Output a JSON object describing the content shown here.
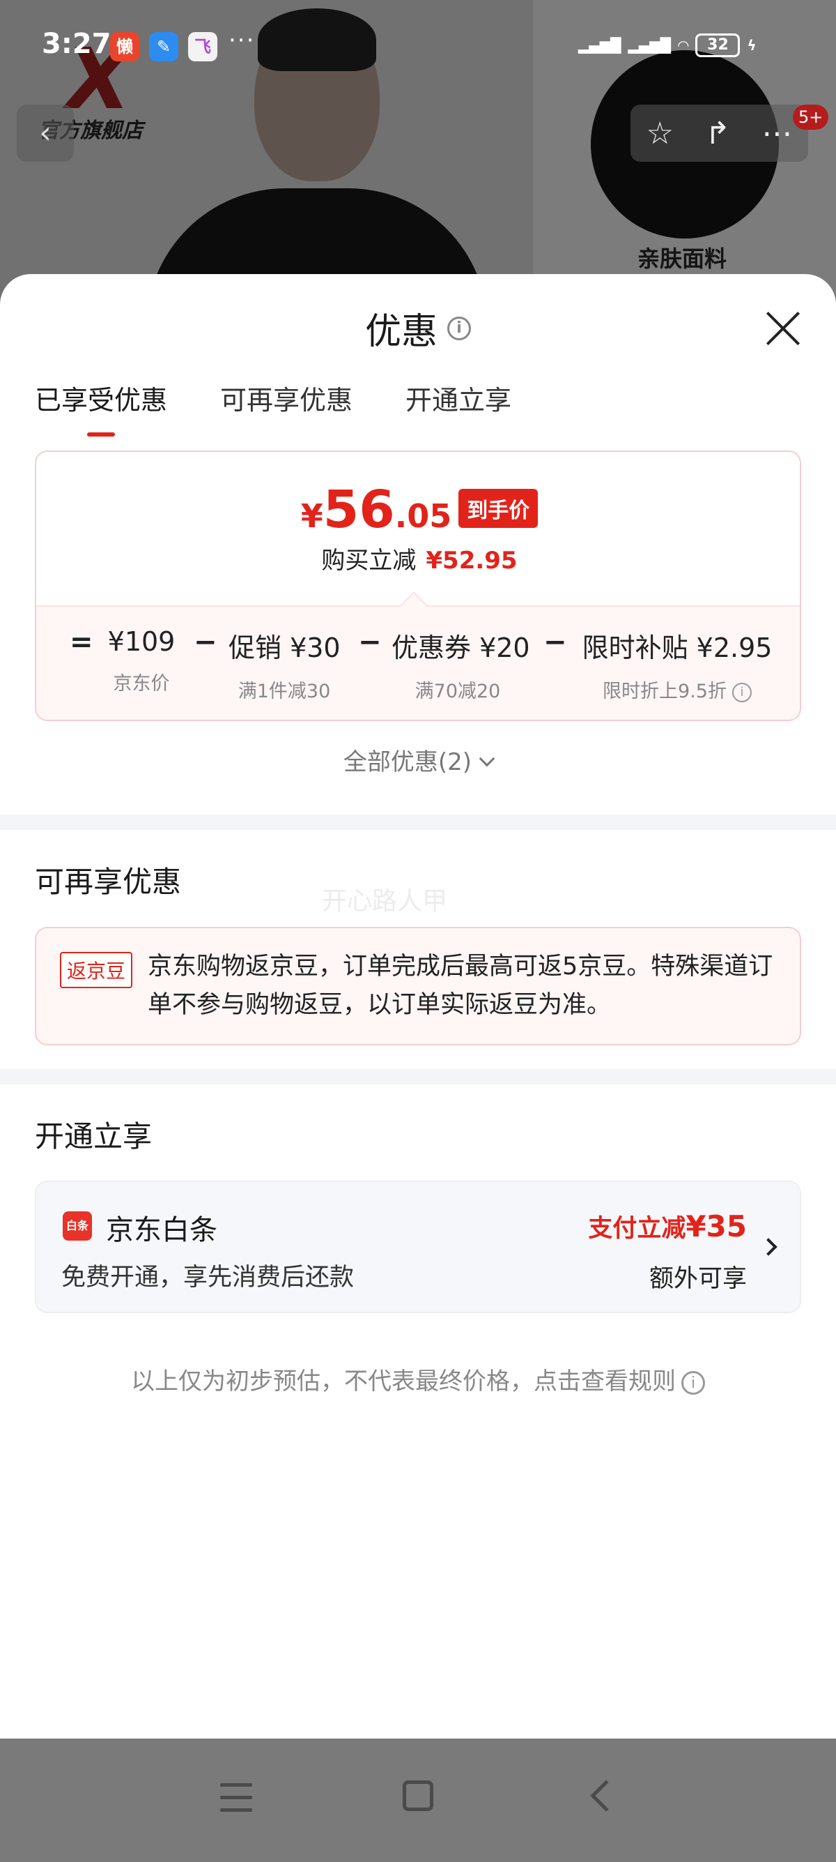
{
  "status_bar": {
    "time": "3:27",
    "app_icons": [
      "懒",
      "",
      "飞"
    ],
    "more": "···",
    "battery": "32"
  },
  "background_page": {
    "store_name": "官方旗舰店",
    "logo_letter": "X",
    "fabric_label": "亲肤面料",
    "badge": "5+"
  },
  "sheet": {
    "title": "优惠",
    "tabs": [
      "已享受优惠",
      "可再享优惠",
      "开通立享"
    ],
    "active_tab_index": 0,
    "final_price": {
      "currency": "¥",
      "integer": "56",
      "decimal": ".05",
      "tag": "到手价"
    },
    "savings": {
      "label": "购买立减",
      "amount": "¥52.95"
    },
    "breakdown": {
      "equals": "=",
      "minus": "−",
      "items": [
        {
          "value": "¥109",
          "sub": "京东价"
        },
        {
          "value": "促销 ¥30",
          "sub": "满1件减30"
        },
        {
          "value": "优惠券 ¥20",
          "sub": "满70减20"
        },
        {
          "value": "限时补贴 ¥2.95",
          "sub": "限时折上9.5折"
        }
      ]
    },
    "all_deals": "全部优惠(2)",
    "section_more": {
      "title": "可再享优惠",
      "watermark": "开心路人甲",
      "bean_tag": "返京豆",
      "bean_text": "京东购物返京豆，订单完成后最高可返5京豆。特殊渠道订单不参与购物返豆，以订单实际返豆为准。"
    },
    "section_open": {
      "title": "开通立享",
      "logo_text": "白条",
      "name": "京东白条",
      "desc": "免费开通，享先消费后还款",
      "promo_label": "支付立减",
      "promo_amount": "¥35",
      "extra": "额外可享"
    },
    "disclaimer": "以上仅为初步预估，不代表最终价格，点击查看规则"
  },
  "colors": {
    "accent_red": "#e2231a",
    "card_pink_bg": "#fff6f6",
    "card_pink_border": "#f6cdd1",
    "band_gray": "#f3f5f8"
  },
  "icons": [
    "info-icon",
    "close-icon",
    "chevron-down-icon",
    "chevron-right-icon",
    "star-icon",
    "share-icon",
    "more-icon",
    "back-icon",
    "menu-nav-icon",
    "home-nav-icon",
    "back-nav-icon"
  ]
}
